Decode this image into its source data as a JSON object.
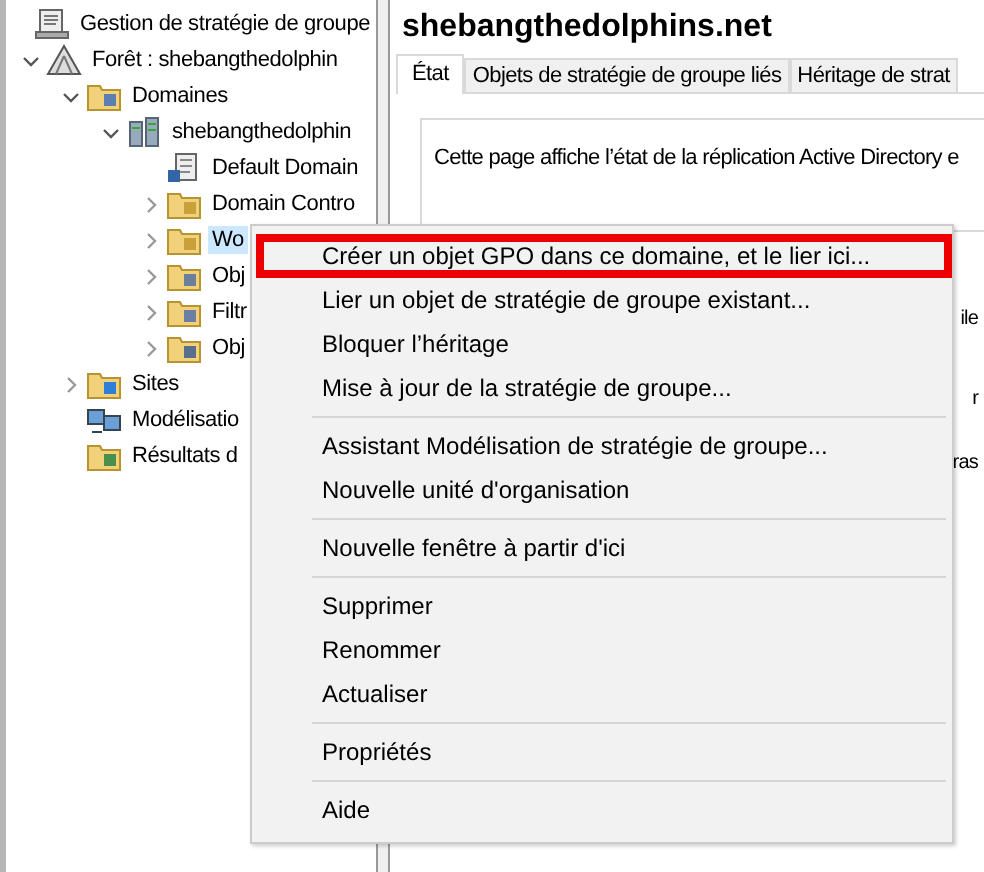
{
  "tree": [
    {
      "label": "Gestion de stratégie de groupe",
      "kind": "console",
      "selected": false,
      "children": [
        {
          "label": "Forêt : shebangthedolphin",
          "kind": "forest",
          "expanded": true,
          "selected": false,
          "children": [
            {
              "label": "Domaines",
              "kind": "domains",
              "expanded": true,
              "selected": false,
              "children": [
                {
                  "label": "shebangthedolphin",
                  "kind": "domain",
                  "expanded": true,
                  "selected": false,
                  "children": [
                    {
                      "label": "Default Domain",
                      "kind": "gpo",
                      "selected": false
                    },
                    {
                      "label": "Domain Contro",
                      "kind": "ou",
                      "expanded": false,
                      "selected": false
                    },
                    {
                      "label": "Wo",
                      "kind": "ou",
                      "expanded": false,
                      "selected": true
                    },
                    {
                      "label": "Obj",
                      "kind": "gpofolder",
                      "expanded": false,
                      "selected": false
                    },
                    {
                      "label": "Filtr",
                      "kind": "wmi",
                      "expanded": false,
                      "selected": false
                    },
                    {
                      "label": "Obj",
                      "kind": "starter",
                      "expanded": false,
                      "selected": false
                    }
                  ]
                }
              ]
            },
            {
              "label": "Sites",
              "kind": "sites",
              "expanded": false,
              "selected": false
            },
            {
              "label": "Modélisatio",
              "kind": "modeling",
              "selected": false
            },
            {
              "label": "Résultats d",
              "kind": "results",
              "selected": false
            }
          ]
        }
      ]
    }
  ],
  "panel": {
    "title": "shebangthedolphins.net",
    "tabs": [
      {
        "label": "État",
        "selected": true
      },
      {
        "label": "Objets de stratégie de groupe liés",
        "selected": false
      },
      {
        "label": "Héritage de strat",
        "selected": false
      }
    ],
    "description": "Cette page affiche l’état de la réplication Active Directory e",
    "fragments": [
      "ile",
      "r",
      "ras"
    ]
  },
  "context_menu": {
    "groups": [
      [
        {
          "label": "Créer un objet GPO dans ce domaine, et le lier ici...",
          "annotated": true
        },
        {
          "label": "Lier un objet de stratégie de groupe existant...",
          "annotated": false
        },
        {
          "label": "Bloquer l’héritage",
          "annotated": false
        },
        {
          "label": "Mise à jour de la stratégie de groupe...",
          "annotated": false
        }
      ],
      [
        {
          "label": "Assistant Modélisation de stratégie de groupe...",
          "annotated": false
        },
        {
          "label": "Nouvelle unité d'organisation",
          "annotated": false
        }
      ],
      [
        {
          "label": "Nouvelle fenêtre à partir d'ici",
          "annotated": false
        }
      ],
      [
        {
          "label": "Supprimer",
          "annotated": false
        },
        {
          "label": "Renommer",
          "annotated": false
        },
        {
          "label": "Actualiser",
          "annotated": false
        }
      ],
      [
        {
          "label": "Propriétés",
          "annotated": false
        }
      ],
      [
        {
          "label": "Aide",
          "annotated": false
        }
      ]
    ]
  }
}
